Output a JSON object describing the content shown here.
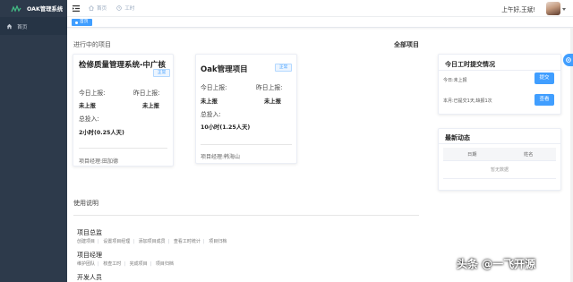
{
  "app": {
    "title": "OAK管理系统"
  },
  "sidebar": {
    "items": [
      {
        "label": "首页",
        "icon": "home-icon"
      }
    ]
  },
  "topbar": {
    "breadcrumb": [
      {
        "label": "首页",
        "icon": "home-icon"
      },
      {
        "label": "工时",
        "icon": "clock-icon"
      }
    ],
    "greeting": "上午好,王斌!"
  },
  "tags": [
    {
      "label": "首页"
    }
  ],
  "projects": {
    "section_title": "进行中的项目",
    "all_link": "全部项目",
    "items": [
      {
        "name": "检修质量管理系统-中广核",
        "status": "正常",
        "today_label": "今日上报:",
        "yesterday_label": "昨日上报:",
        "today": "未上报",
        "yesterday": "未上报",
        "total_label": "总投入:",
        "total": "2小时(0.25人天)",
        "manager": "项目经理:田加德"
      },
      {
        "name": "Oak管理项目",
        "status": "正常",
        "today_label": "今日上报:",
        "yesterday_label": "昨日上报:",
        "today": "未上报",
        "yesterday": "未上报",
        "total_label": "总投入:",
        "total": "10小时(1.25人天)",
        "manager": "项目经理:韩海山"
      }
    ]
  },
  "usage": {
    "title": "使用说明",
    "groups": [
      {
        "title": "项目总监",
        "links": [
          "创建项目",
          "设置项目经理",
          "添加项目成员",
          "查看工时统计",
          "项目归档"
        ]
      },
      {
        "title": "项目经理",
        "links": [
          "维护团队",
          "核查工时",
          "完成项目",
          "项目归档"
        ]
      },
      {
        "title": "开发人员"
      }
    ]
  },
  "timesheet": {
    "title": "今日工时提交情况",
    "today_text": "今日:未上报",
    "submit_label": "提交",
    "month_text": "本月:已提交1天,缺报1次",
    "view_label": "查看"
  },
  "news": {
    "title": "最新动态",
    "columns": [
      "日期",
      "姓名"
    ],
    "empty_text": "暂无数据"
  },
  "watermark": "头条 @一飞开源",
  "colors": {
    "sidebar_bg": "#2d3a4b",
    "primary": "#409eff"
  }
}
